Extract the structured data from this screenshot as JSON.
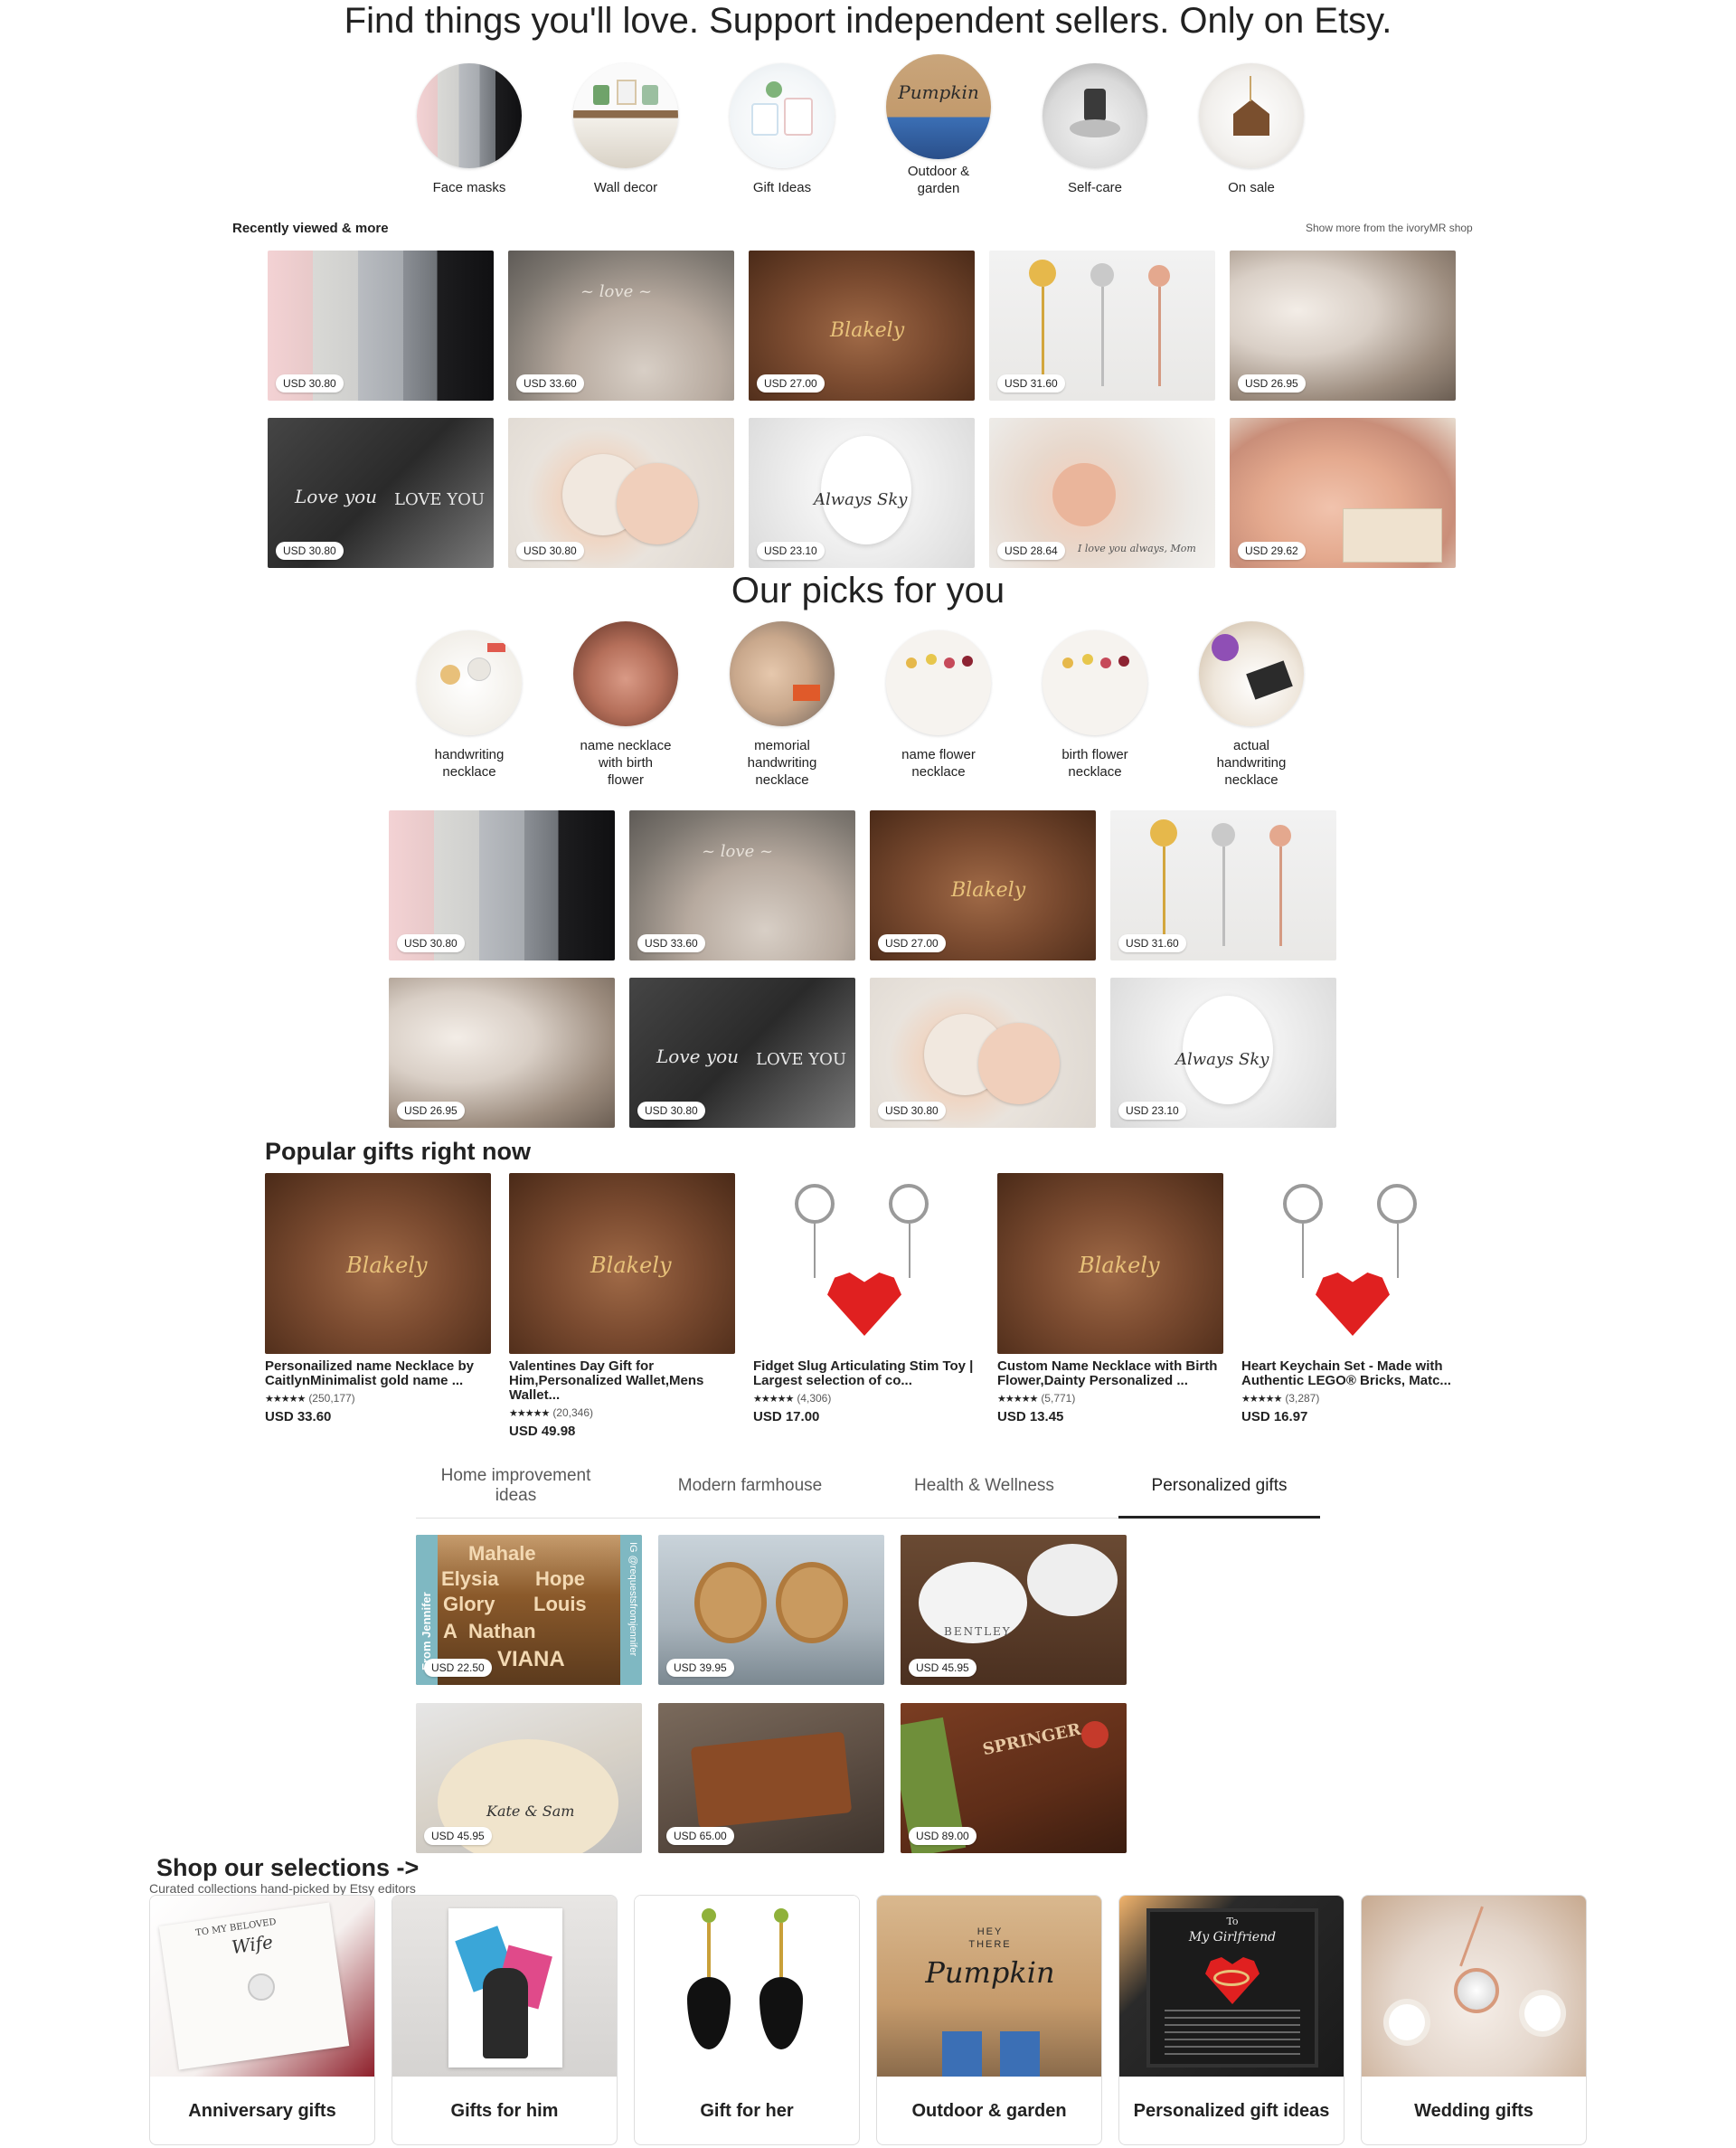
{
  "hero": {
    "title": "Find things you'll love. Support independent sellers. Only on Etsy."
  },
  "categories": [
    {
      "label": "Face masks"
    },
    {
      "label": "Wall decor"
    },
    {
      "label": "Gift Ideas"
    },
    {
      "label": "Outdoor &\ngarden"
    },
    {
      "label": "Self-care"
    },
    {
      "label": "On sale"
    }
  ],
  "recently_viewed": {
    "title": "Recently viewed & more",
    "more_link": "Show more from the ivoryMR shop",
    "prices": [
      "USD 30.80",
      "USD 33.60",
      "USD 27.00",
      "USD 31.60",
      "USD 26.95",
      "USD 30.80",
      "USD 30.80",
      "USD 23.10",
      "USD 28.64",
      "USD 29.62"
    ]
  },
  "picks": {
    "title": "Our picks for you",
    "circles": [
      {
        "label": "handwriting\nnecklace"
      },
      {
        "label": "name necklace\nwith birth\nflower"
      },
      {
        "label": "memorial\nhandwriting\nnecklace"
      },
      {
        "label": "name flower\nnecklace"
      },
      {
        "label": "birth flower\nnecklace"
      },
      {
        "label": "actual\nhandwriting\nnecklace"
      }
    ],
    "prices": [
      "USD 30.80",
      "USD 33.60",
      "USD 27.00",
      "USD 31.60",
      "USD 26.95",
      "USD 30.80",
      "USD 30.80",
      "USD 23.10"
    ]
  },
  "popular": {
    "title": "Popular gifts right now",
    "items": [
      {
        "title": "Personailized name Necklace by CaitlynMinimalist gold name ...",
        "stars": "★★★★★",
        "reviews": "(250,177)",
        "price": "USD 33.60"
      },
      {
        "title": "Valentines Day Gift for Him,Personalized Wallet,Mens Wallet...",
        "stars": "★★★★★",
        "reviews": "(20,346)",
        "price": "USD 49.98"
      },
      {
        "title": "Fidget Slug Articulating Stim Toy | Largest selection of co...",
        "stars": "★★★★★",
        "reviews": "(4,306)",
        "price": "USD 17.00"
      },
      {
        "title": "Custom Name Necklace with Birth Flower,Dainty Personalized ...",
        "stars": "★★★★★",
        "reviews": "(5,771)",
        "price": "USD 13.45"
      },
      {
        "title": "Heart Keychain Set - Made with Authentic LEGO® Bricks, Matc...",
        "stars": "★★★★★",
        "reviews": "(3,287)",
        "price": "USD 16.97"
      }
    ]
  },
  "tabs": [
    {
      "label": "Home improvement\nideas"
    },
    {
      "label": "Modern farmhouse"
    },
    {
      "label": "Health & Wellness"
    },
    {
      "label": "Personalized gifts"
    }
  ],
  "tab_products": {
    "prices": [
      "USD 22.50",
      "USD 39.95",
      "USD 45.95",
      "USD 45.95",
      "USD 65.00",
      "USD 89.00"
    ],
    "sign_words": [
      "Mahale",
      "Elysia",
      "Hope",
      "Glory",
      "Louis",
      "A",
      "Nathan",
      "VIANA"
    ],
    "side_texts": [
      "From Jennifer",
      "IG @requestsfromjennifer"
    ],
    "bowl_text": "BENTLEY",
    "board_text": "Kate & Sam",
    "cutting_text": "SPRINGER"
  },
  "selections": {
    "title": "Shop our selections  ->",
    "subtitle": "Curated collections hand-picked by Etsy editors",
    "items": [
      {
        "label": "Anniversary gifts"
      },
      {
        "label": "Gifts for him"
      },
      {
        "label": "Gift for her"
      },
      {
        "label": "Outdoor & garden"
      },
      {
        "label": "Personalized gift ideas"
      },
      {
        "label": "Wedding gifts"
      }
    ],
    "outdoor_sign": [
      "HEY",
      "THERE",
      "Pumpkin"
    ],
    "pgift_text": [
      "To",
      "My Girlfriend"
    ],
    "anniv_text": [
      "TO MY BELOVED",
      "Wife"
    ]
  },
  "handwriting": {
    "blakely": "Blakely",
    "always": "Always Sky",
    "love_you": "I love you always, Mom"
  }
}
